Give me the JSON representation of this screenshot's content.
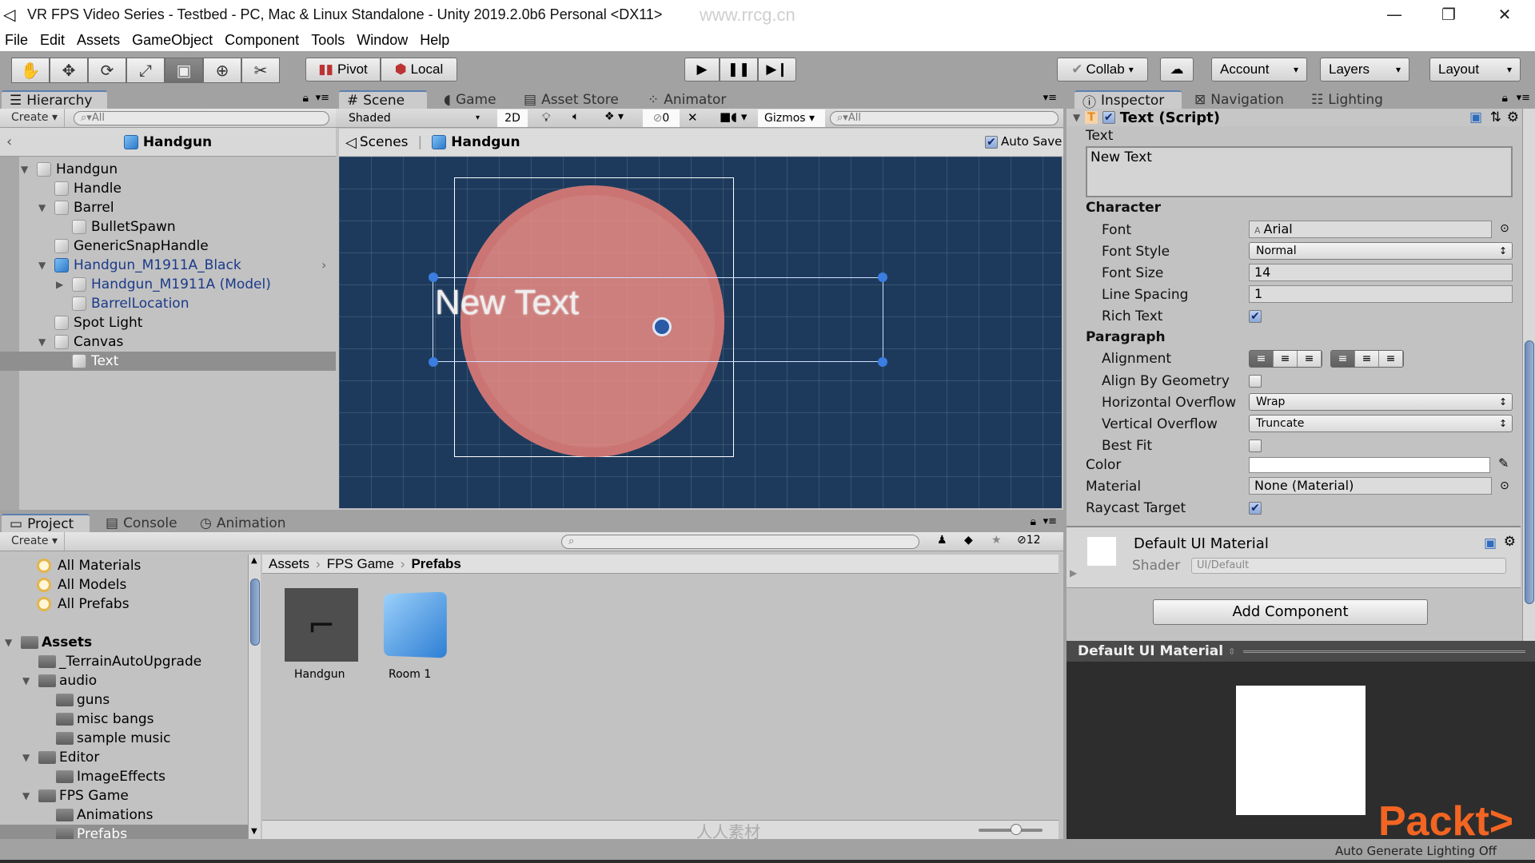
{
  "window": {
    "title": "VR FPS Video Series - Testbed - PC, Mac & Linux Standalone - Unity 2019.2.0b6 Personal <DX11>",
    "controls": {
      "minimize": "—",
      "restore": "❐",
      "close": "✕"
    }
  },
  "menu": [
    "File",
    "Edit",
    "Assets",
    "GameObject",
    "Component",
    "Tools",
    "Window",
    "Help"
  ],
  "toolbar": {
    "tools": [
      {
        "name": "hand-tool",
        "glyph": "✋"
      },
      {
        "name": "move-tool",
        "glyph": "✥"
      },
      {
        "name": "rotate-tool",
        "glyph": "⟳"
      },
      {
        "name": "scale-tool",
        "glyph": "⤢"
      },
      {
        "name": "rect-tool",
        "glyph": "▣"
      },
      {
        "name": "transform-tool",
        "glyph": "⊕"
      },
      {
        "name": "custom-tool",
        "glyph": "✂"
      }
    ],
    "active_tool_index": 4,
    "pivot_label": "Pivot",
    "local_label": "Local",
    "play_glyph": "▶",
    "pause_glyph": "❚❚",
    "step_glyph": "▶❙",
    "collab_label": "Collab",
    "cloud_glyph": "☁",
    "account_label": "Account",
    "layers_label": "Layers",
    "layout_label": "Layout",
    "dropdown_glyph": "▾"
  },
  "hierarchy": {
    "tab_label": "Hierarchy",
    "create_label": "Create",
    "search_placeholder": "All",
    "scene_header": "Handgun",
    "items": [
      {
        "label": "Handgun",
        "depth": 0,
        "expanded": "open",
        "icon": "cube",
        "prefab": false
      },
      {
        "label": "Handle",
        "depth": 1,
        "expanded": "none",
        "icon": "cube",
        "prefab": false
      },
      {
        "label": "Barrel",
        "depth": 1,
        "expanded": "open",
        "icon": "cube",
        "prefab": false
      },
      {
        "label": "BulletSpawn",
        "depth": 2,
        "expanded": "none",
        "icon": "cube",
        "prefab": false
      },
      {
        "label": "GenericSnapHandle",
        "depth": 1,
        "expanded": "none",
        "icon": "cube",
        "prefab": false
      },
      {
        "label": "Handgun_M1911A_Black",
        "depth": 1,
        "expanded": "open",
        "icon": "cube-blue",
        "prefab": true
      },
      {
        "label": "Handgun_M1911A (Model)",
        "depth": 2,
        "expanded": "closed",
        "icon": "cube",
        "prefab": true
      },
      {
        "label": "BarrelLocation",
        "depth": 2,
        "expanded": "none",
        "icon": "cube",
        "prefab": true
      },
      {
        "label": "Spot Light",
        "depth": 1,
        "expanded": "none",
        "icon": "cube",
        "prefab": false
      },
      {
        "label": "Canvas",
        "depth": 1,
        "expanded": "open",
        "icon": "cube",
        "prefab": false
      },
      {
        "label": "Text",
        "depth": 2,
        "expanded": "none",
        "icon": "cube",
        "prefab": false,
        "selected": true
      }
    ]
  },
  "scene": {
    "tabs": [
      "Scene",
      "Game",
      "Asset Store",
      "Animator"
    ],
    "active_tab": 0,
    "shading_mode": "Shaded",
    "mode_2d_label": "2D",
    "hidden_count": "0",
    "gizmos_label": "Gizmos",
    "search_placeholder": "All",
    "breadcrumb_root": "Scenes",
    "breadcrumb_prefab": "Handgun",
    "auto_save_label": "Auto Save",
    "auto_save_checked": true,
    "canvas_text": "New Text"
  },
  "project": {
    "tabs": [
      "Project",
      "Console",
      "Animation"
    ],
    "active_tab": 0,
    "create_label": "Create",
    "favorites": [
      "All Materials",
      "All Models",
      "All Prefabs"
    ],
    "tree": [
      {
        "label": "Assets",
        "depth": 0,
        "expanded": "open",
        "bold": true
      },
      {
        "label": "_TerrainAutoUpgrade",
        "depth": 1,
        "expanded": "none"
      },
      {
        "label": "audio",
        "depth": 1,
        "expanded": "open"
      },
      {
        "label": "guns",
        "depth": 2,
        "expanded": "none"
      },
      {
        "label": "misc bangs",
        "depth": 2,
        "expanded": "none"
      },
      {
        "label": "sample music",
        "depth": 2,
        "expanded": "none"
      },
      {
        "label": "Editor",
        "depth": 1,
        "expanded": "open"
      },
      {
        "label": "ImageEffects",
        "depth": 2,
        "expanded": "none"
      },
      {
        "label": "FPS Game",
        "depth": 1,
        "expanded": "open"
      },
      {
        "label": "Animations",
        "depth": 2,
        "expanded": "none"
      },
      {
        "label": "Prefabs",
        "depth": 2,
        "expanded": "none",
        "selected": true
      }
    ],
    "breadcrumb": [
      "Assets",
      "FPS Game",
      "Prefabs"
    ],
    "hidden_count": "12",
    "assets": [
      {
        "label": "Handgun",
        "type": "handgun-prefab"
      },
      {
        "label": "Room 1",
        "type": "cube-prefab"
      }
    ]
  },
  "inspector": {
    "tabs": [
      "Inspector",
      "Navigation",
      "Lighting"
    ],
    "active_tab": 0,
    "component_title": "Text (Script)",
    "component_enabled": true,
    "text_label": "Text",
    "text_value": "New Text",
    "character_header": "Character",
    "font_label": "Font",
    "font_value": "Arial",
    "font_style_label": "Font Style",
    "font_style_value": "Normal",
    "font_size_label": "Font Size",
    "font_size_value": "14",
    "line_spacing_label": "Line Spacing",
    "line_spacing_value": "1",
    "rich_text_label": "Rich Text",
    "rich_text_checked": true,
    "paragraph_header": "Paragraph",
    "alignment_label": "Alignment",
    "align_by_geometry_label": "Align By Geometry",
    "align_by_geometry_checked": false,
    "h_overflow_label": "Horizontal Overflow",
    "h_overflow_value": "Wrap",
    "v_overflow_label": "Vertical Overflow",
    "v_overflow_value": "Truncate",
    "best_fit_label": "Best Fit",
    "best_fit_checked": false,
    "color_label": "Color",
    "color_value": "#ffffff",
    "material_label": "Material",
    "material_value": "None (Material)",
    "raycast_label": "Raycast Target",
    "raycast_checked": true,
    "material_section_title": "Default UI Material",
    "shader_label": "Shader",
    "shader_value": "UI/Default",
    "add_component_label": "Add Component",
    "preview_title": "Default UI Material"
  },
  "status": {
    "right_text": "Auto Generate Lighting Off"
  },
  "watermarks": {
    "top": "www.rrcg.cn",
    "bottom": "人人素材",
    "brand": "Packt>"
  },
  "colors": {
    "scene_bg": "#1d3a5c",
    "prefab_text": "#1b3a8a",
    "selection": "#8f8f8f",
    "packt": "#f26522"
  }
}
